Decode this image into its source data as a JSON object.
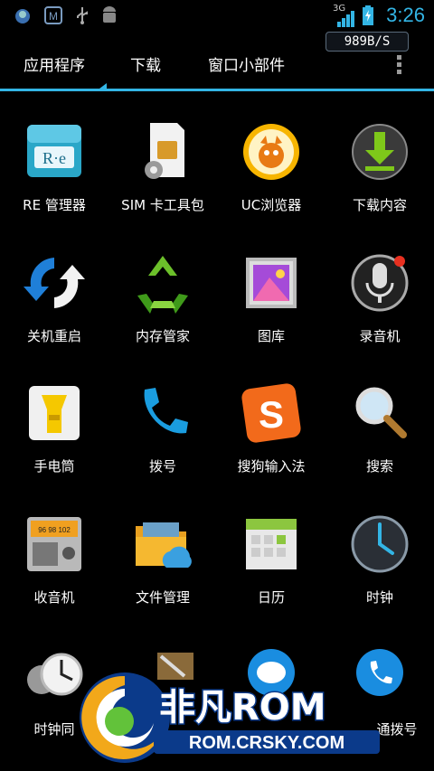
{
  "status_bar": {
    "time": "3:26",
    "network": "3G",
    "net_speed": "989B/S",
    "icons": [
      "bird-icon",
      "m-app-icon",
      "usb-icon",
      "android-debug-icon",
      "signal-icon",
      "battery-icon"
    ]
  },
  "tabs": [
    {
      "label": "应用程序",
      "selected": true
    },
    {
      "label": "下载",
      "selected": false
    },
    {
      "label": "窗口小部件",
      "selected": false
    }
  ],
  "apps": [
    {
      "label": "RE 管理器",
      "icon": "re-manager-icon"
    },
    {
      "label": "SIM 卡工具包",
      "icon": "sim-toolkit-icon"
    },
    {
      "label": "UC浏览器",
      "icon": "uc-browser-icon"
    },
    {
      "label": "下载内容",
      "icon": "downloads-icon"
    },
    {
      "label": "关机重启",
      "icon": "reboot-icon"
    },
    {
      "label": "内存管家",
      "icon": "memory-manager-icon"
    },
    {
      "label": "图库",
      "icon": "gallery-icon"
    },
    {
      "label": "录音机",
      "icon": "recorder-icon"
    },
    {
      "label": "手电筒",
      "icon": "flashlight-icon"
    },
    {
      "label": "拨号",
      "icon": "phone-icon"
    },
    {
      "label": "搜狗输入法",
      "icon": "sogou-input-icon"
    },
    {
      "label": "搜索",
      "icon": "search-icon"
    },
    {
      "label": "收音机",
      "icon": "radio-icon"
    },
    {
      "label": "文件管理",
      "icon": "file-manager-icon"
    },
    {
      "label": "日历",
      "icon": "calendar-icon"
    },
    {
      "label": "时钟",
      "icon": "clock-icon"
    },
    {
      "label": "时钟同",
      "icon": "clock-sync-icon"
    },
    {
      "label": "",
      "icon": "toolbox-icon"
    },
    {
      "label": "",
      "icon": "messaging-icon"
    },
    {
      "label": "通拨号",
      "icon": "voip-dial-icon"
    }
  ],
  "watermark": {
    "brand": "非凡ROM",
    "url": "ROM.CRSKY.COM"
  },
  "colors": {
    "accent": "#33b5e5",
    "background": "#000000"
  }
}
